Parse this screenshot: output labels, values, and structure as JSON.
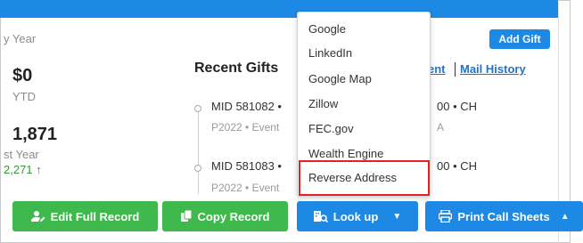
{
  "summary": {
    "fiscal_year_label": "y Year",
    "ytd_amount": "$0",
    "ytd_label": "YTD",
    "last_year_amount": "1,871",
    "last_year_label": "st Year",
    "last_year_change": "2,271 ↑"
  },
  "recent_gifts": {
    "title": "Recent Gifts",
    "items": [
      {
        "main": "MID 581082 •",
        "sub": "P2022 • Event",
        "amount_suffix": "00 • CH",
        "sub_suffix": "A"
      },
      {
        "main": "MID 581083 •",
        "sub": "P2022 • Event",
        "amount_suffix": "00 • CH",
        "sub_suffix": ""
      }
    ]
  },
  "links": {
    "events_partial": "ent",
    "mail_history": "Mail History"
  },
  "add_gift_label": "Add Gift",
  "lookup_menu": {
    "items": [
      "Google",
      "LinkedIn",
      "Google Map",
      "Zillow",
      "FEC.gov",
      "Wealth Engine",
      "Reverse Address"
    ],
    "highlighted": "Reverse Address"
  },
  "actions": {
    "edit_full_record": "Edit Full Record",
    "copy_record": "Copy Record",
    "look_up": "Look up",
    "print_call_sheets": "Print Call Sheets"
  },
  "colors": {
    "primary_blue": "#1e88e5",
    "action_green": "#3fb84d",
    "link_blue": "#1e73d6",
    "highlight_red": "#e02424",
    "positive_green": "#2e9d3a"
  }
}
